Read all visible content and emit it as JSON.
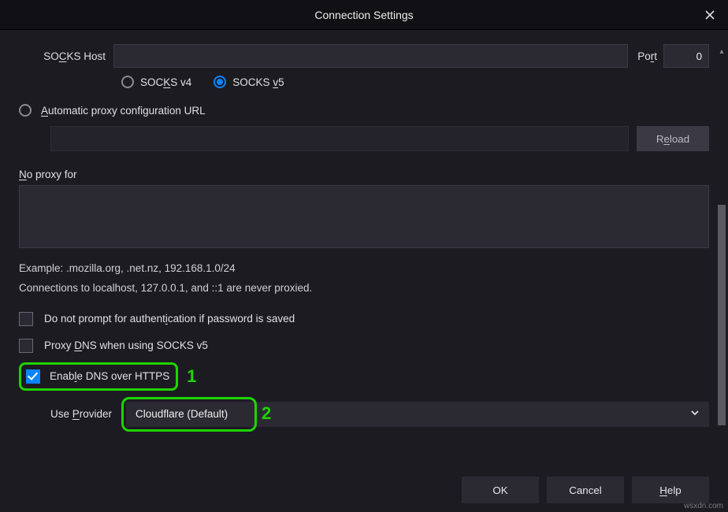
{
  "title": "Connection Settings",
  "socks": {
    "host_label": "SOCKS Host",
    "host_value": "",
    "port_label": "Port",
    "port_value": "0",
    "v4_label": "SOCKS v4",
    "v5_label": "SOCKS v5",
    "selected": "v5"
  },
  "autoconf": {
    "label": "Automatic proxy configuration URL",
    "url_value": "",
    "reload_label": "Reload"
  },
  "noproxy": {
    "label": "No proxy for",
    "value": "",
    "example": "Example: .mozilla.org, .net.nz, 192.168.1.0/24",
    "note": "Connections to localhost, 127.0.0.1, and ::1 are never proxied."
  },
  "checkboxes": {
    "no_prompt": "Do not prompt for authentication if password is saved",
    "proxy_dns": "Proxy DNS when using SOCKS v5",
    "enable_doh": "Enable DNS over HTTPS"
  },
  "provider": {
    "label": "Use Provider",
    "value": "Cloudflare (Default)"
  },
  "annotations": {
    "one": "1",
    "two": "2"
  },
  "buttons": {
    "ok": "OK",
    "cancel": "Cancel",
    "help": "Help"
  },
  "watermark": "wsxdn.com"
}
